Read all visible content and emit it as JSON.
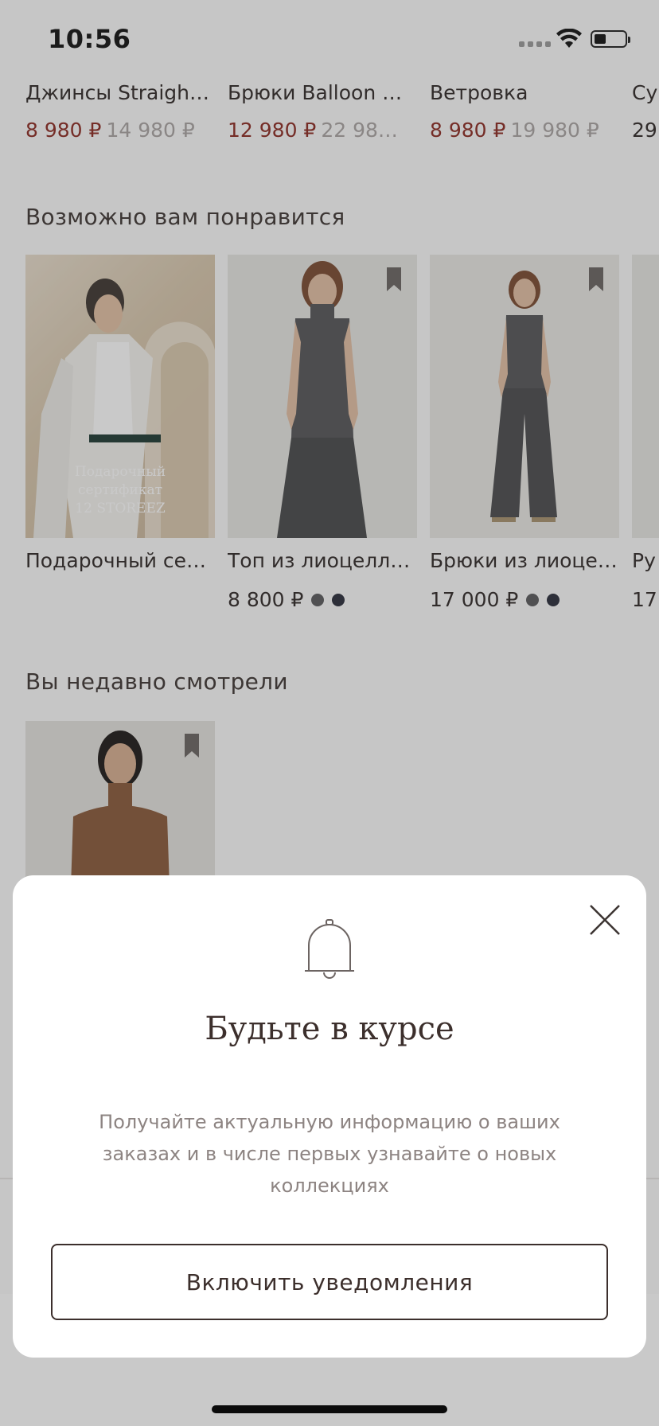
{
  "status": {
    "time": "10:56"
  },
  "sale_items": [
    {
      "name": "Джинсы Straight…",
      "sale": "8 980 ₽",
      "old": "14 980 ₽"
    },
    {
      "name": "Брюки Balloon и…",
      "sale": "12 980 ₽",
      "old": "22 98…"
    },
    {
      "name": "Ветровка",
      "sale": "8 980 ₽",
      "old": "19 980 ₽"
    },
    {
      "name": "Су",
      "sale": "",
      "old": "29"
    }
  ],
  "recommended": {
    "title": "Возможно вам понравится",
    "items": [
      {
        "title": "Подарочный се…",
        "price": "",
        "image_caption": "Подарочный\nсертификат\n12 STOREEZ"
      },
      {
        "title": "Топ из лиоцелл…",
        "price": "8 800 ₽",
        "swatches": [
          "#5a5a5c",
          "#2a2c3a"
        ]
      },
      {
        "title": "Брюки из лиоце…",
        "price": "17 000 ₽",
        "swatches": [
          "#5a5a5c",
          "#2a2c3a"
        ]
      },
      {
        "title": "Ру",
        "price": "17"
      }
    ]
  },
  "recent": {
    "title": "Вы недавно смотрели"
  },
  "notification_sheet": {
    "title": "Будьте в курсе",
    "text": "Получайте актуальную информацию о ваших заказах и в числе первых узнавайте о новых коллекциях",
    "button": "Включить уведомления"
  },
  "colors": {
    "sale": "#8c2a22",
    "brand_text": "#3c2f2c"
  }
}
